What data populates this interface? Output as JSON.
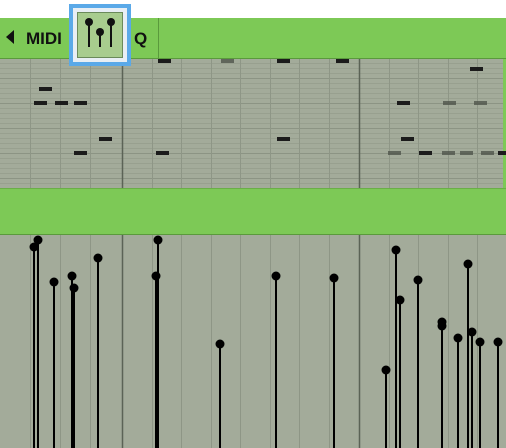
{
  "toolbar": {
    "back_label": "MIDI",
    "quantize_label": "Q",
    "velocity_tool_icon": "velocity-lollipop-icon"
  },
  "colors": {
    "toolbar_green": "#7dc956",
    "grid_background": "#a3ab9a",
    "selection_blue": "#5aa9e8",
    "note_color": "#222222",
    "velocity_color": "#000000"
  },
  "piano_roll": {
    "notes": [
      {
        "start": 1.0,
        "row": 8,
        "length": 0.08
      },
      {
        "start": 1.02,
        "row": 4,
        "length": 0.07
      },
      {
        "start": 1.09,
        "row": 8,
        "length": 0.07
      },
      {
        "start": 1.16,
        "row": 8,
        "length": 0.07
      },
      {
        "start": 1.16,
        "row": 18,
        "length": 0.07
      },
      {
        "start": 1.25,
        "row": 16,
        "length": 0.07
      },
      {
        "start": 1.82,
        "row": 0,
        "length": 0.07
      },
      {
        "start": 1.82,
        "row": 18,
        "length": 0.07
      },
      {
        "start": 2.36,
        "row": 0,
        "length": 0.07
      },
      {
        "start": 2.66,
        "row": 0,
        "length": 0.07
      },
      {
        "start": 2.66,
        "row": 16,
        "length": 0.07
      },
      {
        "start": 3.07,
        "row": 0,
        "length": 0.07
      },
      {
        "start": 3.46,
        "row": 16,
        "length": 0.07
      },
      {
        "start": 3.48,
        "row": 8,
        "length": 0.07
      },
      {
        "start": 3.64,
        "row": 18,
        "length": 0.07
      },
      {
        "start": 3.72,
        "row": 18,
        "length": 0.07
      },
      {
        "start": 3.8,
        "row": 18,
        "length": 0.07
      },
      {
        "start": 3.82,
        "row": 8,
        "length": 0.07
      },
      {
        "start": 3.9,
        "row": 18,
        "length": 0.07
      },
      {
        "start": 3.98,
        "row": 18,
        "length": 0.07
      },
      {
        "start": 4.03,
        "row": 18,
        "length": 0.05
      },
      {
        "start": 3.88,
        "row": 1,
        "length": 0.07
      },
      {
        "start": 3.98,
        "row": 8,
        "length": 0.07
      }
    ],
    "muted_notes": [
      {
        "start": 2.36,
        "row": 0
      },
      {
        "start": 3.82,
        "row": 8
      },
      {
        "start": 3.39,
        "row": 18
      },
      {
        "start": 3.98,
        "row": 8
      }
    ]
  },
  "velocity_lane": {
    "events": [
      {
        "start": 1.0,
        "velocity": 95
      },
      {
        "start": 1.01,
        "velocity": 98
      },
      {
        "start": 1.09,
        "velocity": 78
      },
      {
        "start": 1.16,
        "velocity": 81
      },
      {
        "start": 1.17,
        "velocity": 76
      },
      {
        "start": 1.25,
        "velocity": 89
      },
      {
        "start": 1.72,
        "velocity": 81
      },
      {
        "start": 1.74,
        "velocity": 98
      },
      {
        "start": 2.0,
        "velocity": 48
      },
      {
        "start": 2.37,
        "velocity": 81
      },
      {
        "start": 2.62,
        "velocity": 80
      },
      {
        "start": 3.42,
        "velocity": 36
      },
      {
        "start": 3.47,
        "velocity": 93
      },
      {
        "start": 3.49,
        "velocity": 70
      },
      {
        "start": 3.57,
        "velocity": 79
      },
      {
        "start": 3.68,
        "velocity": 58
      },
      {
        "start": 3.68,
        "velocity": 57
      },
      {
        "start": 3.75,
        "velocity": 52
      },
      {
        "start": 3.79,
        "velocity": 87
      },
      {
        "start": 3.81,
        "velocity": 54
      },
      {
        "start": 3.84,
        "velocity": 50
      },
      {
        "start": 3.92,
        "velocity": 50
      }
    ],
    "max_velocity": 100
  }
}
